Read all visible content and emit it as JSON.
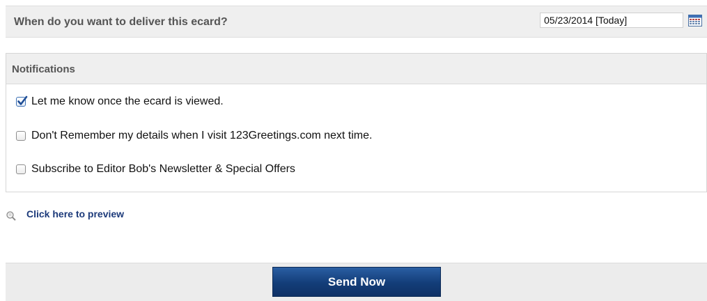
{
  "delivery": {
    "question": "When do you want to deliver this ecard?",
    "date_value": "05/23/2014 [Today]",
    "calendar_icon": "calendar-icon"
  },
  "notifications": {
    "title": "Notifications",
    "options": [
      {
        "label": "Let me know once the ecard is viewed.",
        "checked": true
      },
      {
        "label": "Don't Remember my details when I visit 123Greetings.com next time.",
        "checked": false
      },
      {
        "label": "Subscribe to Editor Bob's Newsletter & Special Offers",
        "checked": false
      }
    ]
  },
  "preview": {
    "icon": "magnifier-icon",
    "link_text": "Click here to preview"
  },
  "actions": {
    "send_label": "Send Now"
  },
  "colors": {
    "accent": "#1c3a7a",
    "button": "#133d78",
    "panel": "#efefef"
  }
}
